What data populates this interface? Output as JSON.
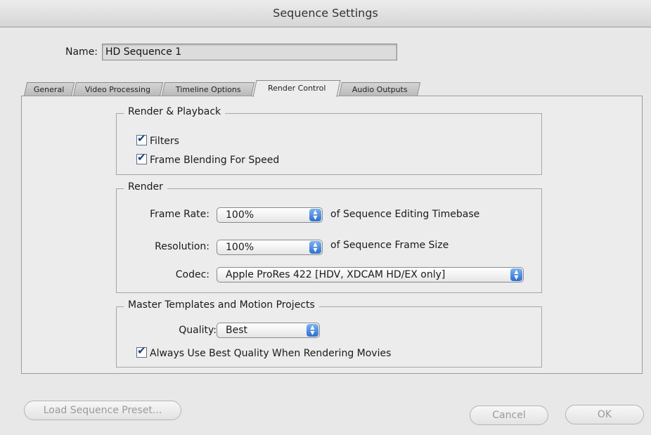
{
  "window": {
    "title": "Sequence Settings"
  },
  "name_field": {
    "label": "Name:",
    "value": "HD Sequence 1"
  },
  "tabs": [
    {
      "label": "General"
    },
    {
      "label": "Video Processing"
    },
    {
      "label": "Timeline Options"
    },
    {
      "label": "Render Control",
      "active": true
    },
    {
      "label": "Audio Outputs"
    }
  ],
  "render_playback": {
    "title": "Render & Playback",
    "filters": {
      "label": "Filters",
      "checked": true
    },
    "frame_blending": {
      "label": "Frame Blending For Speed",
      "checked": true
    }
  },
  "render": {
    "title": "Render",
    "frame_rate": {
      "label": "Frame Rate:",
      "value": "100%",
      "suffix": "of Sequence Editing Timebase"
    },
    "resolution": {
      "label": "Resolution:",
      "value": "100%",
      "suffix": "of Sequence Frame Size"
    },
    "codec": {
      "label": "Codec:",
      "value": "Apple ProRes 422 [HDV, XDCAM HD/EX only]"
    }
  },
  "master_templates": {
    "title": "Master Templates and Motion Projects",
    "quality": {
      "label": "Quality:",
      "value": "Best"
    },
    "always_best": {
      "label": "Always Use Best Quality When Rendering Movies",
      "checked": true
    }
  },
  "buttons": {
    "load_preset": "Load Sequence Preset...",
    "cancel": "Cancel",
    "ok": "OK"
  }
}
